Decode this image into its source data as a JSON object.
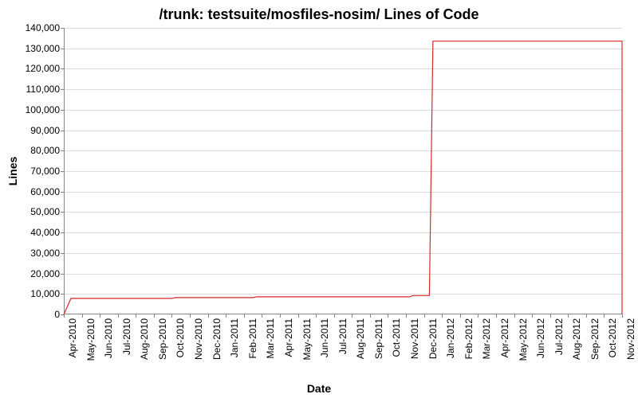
{
  "chart_data": {
    "type": "line",
    "title": "/trunk: testsuite/mosfiles-nosim/ Lines of Code",
    "xlabel": "Date",
    "ylabel": "Lines",
    "ylim": [
      0,
      140000
    ],
    "y_ticks": [
      0,
      10000,
      20000,
      30000,
      40000,
      50000,
      60000,
      70000,
      80000,
      90000,
      100000,
      110000,
      120000,
      130000,
      140000
    ],
    "y_tick_labels": [
      "0",
      "10,000",
      "20,000",
      "30,000",
      "40,000",
      "50,000",
      "60,000",
      "70,000",
      "80,000",
      "90,000",
      "100,000",
      "110,000",
      "120,000",
      "130,000",
      "140,000"
    ],
    "categories": [
      "Apr-2010",
      "May-2010",
      "Jun-2010",
      "Jul-2010",
      "Aug-2010",
      "Sep-2010",
      "Oct-2010",
      "Nov-2010",
      "Dec-2010",
      "Jan-2011",
      "Feb-2011",
      "Mar-2011",
      "Apr-2011",
      "May-2011",
      "Jun-2011",
      "Jul-2011",
      "Aug-2011",
      "Sep-2011",
      "Oct-2011",
      "Nov-2011",
      "Dec-2011",
      "Jan-2012",
      "Feb-2012",
      "Mar-2012",
      "Apr-2012",
      "May-2012",
      "Jun-2012",
      "Jul-2012",
      "Aug-2012",
      "Sep-2012",
      "Oct-2012",
      "Nov-2012"
    ],
    "series": [
      {
        "name": "Lines of Code",
        "color": "#d62728",
        "x_index": [
          0,
          0.4,
          6,
          6.2,
          10.5,
          10.7,
          19.2,
          19.4,
          20.3,
          20.5,
          31,
          31
        ],
        "values": [
          0,
          7800,
          7800,
          8200,
          8200,
          8600,
          8600,
          9200,
          9200,
          133500,
          133500,
          0
        ]
      }
    ]
  }
}
